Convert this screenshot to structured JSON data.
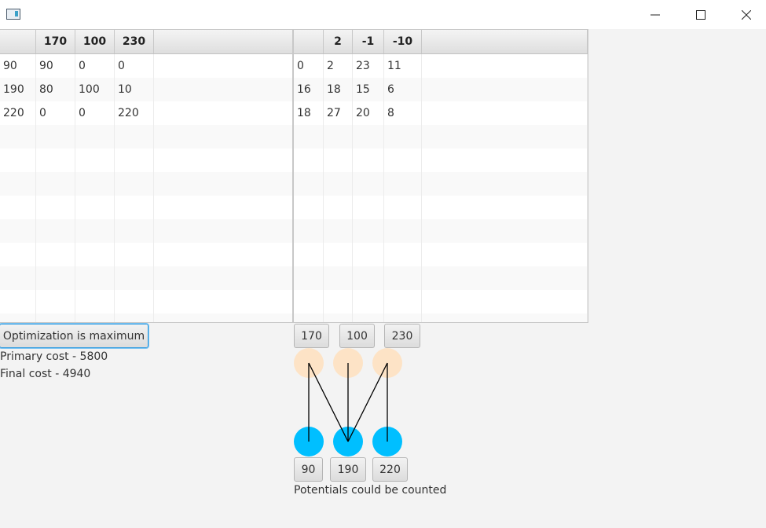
{
  "window": {
    "minimize_icon": "minimize-icon",
    "maximize_icon": "maximize-icon",
    "close_icon": "close-icon"
  },
  "left_table": {
    "headers": [
      "",
      "170",
      "100",
      "230",
      ""
    ],
    "rows": [
      [
        "90",
        "90",
        "0",
        "0",
        ""
      ],
      [
        "190",
        "80",
        "100",
        "10",
        ""
      ],
      [
        "220",
        "0",
        "0",
        "220",
        ""
      ]
    ]
  },
  "right_table": {
    "headers": [
      "",
      "2",
      "-1",
      "-10",
      ""
    ],
    "rows": [
      [
        "0",
        "2",
        "23",
        "11",
        ""
      ],
      [
        "16",
        "18",
        "15",
        "6",
        ""
      ],
      [
        "18",
        "27",
        "20",
        "8",
        ""
      ]
    ]
  },
  "optimization_button": "Optimization is maximum",
  "primary_cost": "Primary cost - 5800",
  "final_cost": "Final cost - 4940",
  "supplier_buttons": [
    "170",
    "100",
    "230"
  ],
  "consumer_buttons": [
    "90",
    "190",
    "220"
  ],
  "status": "Potentials could be counted",
  "colors": {
    "top_node": "#fde3c6",
    "bottom_node": "#00bfff"
  }
}
